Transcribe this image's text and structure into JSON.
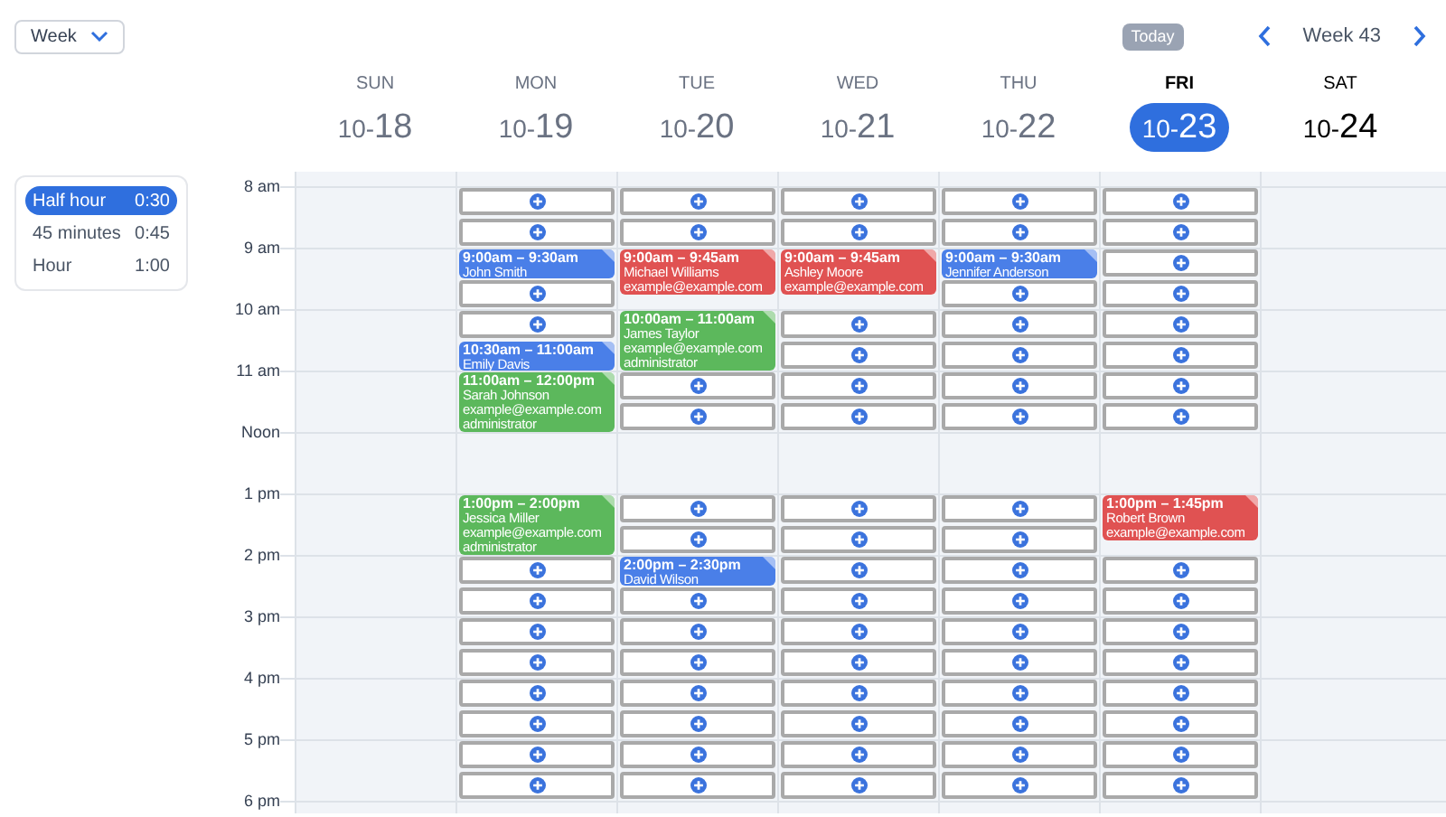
{
  "view_select": {
    "value": "Week"
  },
  "toolbar": {
    "today": "Today",
    "week_label": "Week 43"
  },
  "durations": [
    {
      "label": "Half hour",
      "value": "0:30",
      "selected": true
    },
    {
      "label": "45 minutes",
      "value": "0:45",
      "selected": false
    },
    {
      "label": "Hour",
      "value": "1:00",
      "selected": false
    }
  ],
  "time_labels": [
    "8 am",
    "9 am",
    "10 am",
    "11 am",
    "Noon",
    "1 pm",
    "2 pm",
    "3 pm",
    "4 pm",
    "5 pm",
    "6 pm"
  ],
  "days": [
    {
      "name": "SUN",
      "month": "10-",
      "day": "18",
      "selected": false,
      "past": true
    },
    {
      "name": "MON",
      "month": "10-",
      "day": "19",
      "selected": false,
      "past": true,
      "cells": [
        {
          "kind": "slot"
        },
        {
          "kind": "slot"
        },
        {
          "kind": "short",
          "color": "#4a7fe8",
          "time": "9:00am – 9:30am",
          "lines": [
            "John Smith"
          ]
        },
        {
          "kind": "slot"
        },
        {
          "kind": "slot"
        },
        {
          "kind": "short",
          "color": "#4a7fe8",
          "time": "10:30am – 11:00am",
          "lines": [
            "Emily Davis"
          ]
        },
        {
          "kind": "long",
          "color": "#5cb85c",
          "time": "11:00am – 12:00pm",
          "lines": [
            "Sarah Johnson",
            "example@example.com",
            "administrator"
          ]
        },
        {
          "kind": "break"
        },
        {
          "kind": "long",
          "color": "#5cb85c",
          "time": "1:00pm – 2:00pm",
          "lines": [
            "Jessica Miller",
            "example@example.com",
            "administrator"
          ]
        },
        {
          "kind": "slot"
        },
        {
          "kind": "slot"
        },
        {
          "kind": "slot"
        },
        {
          "kind": "slot"
        },
        {
          "kind": "slot"
        },
        {
          "kind": "slot"
        },
        {
          "kind": "slot"
        },
        {
          "kind": "slot"
        }
      ]
    },
    {
      "name": "TUE",
      "month": "10-",
      "day": "20",
      "selected": false,
      "past": true,
      "cells": [
        {
          "kind": "slot"
        },
        {
          "kind": "slot"
        },
        {
          "kind": "medium",
          "color": "#e05252",
          "time": "9:00am – 9:45am",
          "lines": [
            "Michael Williams",
            "example@example.com"
          ]
        },
        {
          "kind": "long",
          "color": "#5cb85c",
          "time": "10:00am – 11:00am",
          "lines": [
            "James Taylor",
            "example@example.com",
            "administrator"
          ]
        },
        {
          "kind": "slot"
        },
        {
          "kind": "slot"
        },
        {
          "kind": "break"
        },
        {
          "kind": "slot"
        },
        {
          "kind": "slot"
        },
        {
          "kind": "short",
          "color": "#4a7fe8",
          "time": "2:00pm – 2:30pm",
          "lines": [
            "David Wilson"
          ]
        },
        {
          "kind": "slot"
        },
        {
          "kind": "slot"
        },
        {
          "kind": "slot"
        },
        {
          "kind": "slot"
        },
        {
          "kind": "slot"
        },
        {
          "kind": "slot"
        },
        {
          "kind": "slot"
        }
      ]
    },
    {
      "name": "WED",
      "month": "10-",
      "day": "21",
      "selected": false,
      "past": true,
      "cells": [
        {
          "kind": "slot"
        },
        {
          "kind": "slot"
        },
        {
          "kind": "medium",
          "color": "#e05252",
          "time": "9:00am – 9:45am",
          "lines": [
            "Ashley Moore",
            "example@example.com"
          ]
        },
        {
          "kind": "slot"
        },
        {
          "kind": "slot"
        },
        {
          "kind": "slot"
        },
        {
          "kind": "slot"
        },
        {
          "kind": "break"
        },
        {
          "kind": "slot"
        },
        {
          "kind": "slot"
        },
        {
          "kind": "slot"
        },
        {
          "kind": "slot"
        },
        {
          "kind": "slot"
        },
        {
          "kind": "slot"
        },
        {
          "kind": "slot"
        },
        {
          "kind": "slot"
        },
        {
          "kind": "slot"
        },
        {
          "kind": "slot"
        }
      ]
    },
    {
      "name": "THU",
      "month": "10-",
      "day": "22",
      "selected": false,
      "past": true,
      "cells": [
        {
          "kind": "slot"
        },
        {
          "kind": "slot"
        },
        {
          "kind": "short",
          "color": "#4a7fe8",
          "time": "9:00am – 9:30am",
          "lines": [
            "Jennifer Anderson"
          ]
        },
        {
          "kind": "slot"
        },
        {
          "kind": "slot"
        },
        {
          "kind": "slot"
        },
        {
          "kind": "slot"
        },
        {
          "kind": "slot"
        },
        {
          "kind": "break"
        },
        {
          "kind": "slot"
        },
        {
          "kind": "slot"
        },
        {
          "kind": "slot"
        },
        {
          "kind": "slot"
        },
        {
          "kind": "slot"
        },
        {
          "kind": "slot"
        },
        {
          "kind": "slot"
        },
        {
          "kind": "slot"
        },
        {
          "kind": "slot"
        },
        {
          "kind": "slot"
        }
      ]
    },
    {
      "name": "FRI",
      "month": "10-",
      "day": "23",
      "selected": true,
      "past": false,
      "cells": [
        {
          "kind": "slot"
        },
        {
          "kind": "slot"
        },
        {
          "kind": "slot"
        },
        {
          "kind": "slot"
        },
        {
          "kind": "slot"
        },
        {
          "kind": "slot"
        },
        {
          "kind": "slot"
        },
        {
          "kind": "slot"
        },
        {
          "kind": "break"
        },
        {
          "kind": "medium",
          "color": "#e05252",
          "time": "1:00pm – 1:45pm",
          "lines": [
            "Robert Brown",
            "example@example.com"
          ]
        },
        {
          "kind": "slot"
        },
        {
          "kind": "slot"
        },
        {
          "kind": "slot"
        },
        {
          "kind": "slot"
        },
        {
          "kind": "slot"
        },
        {
          "kind": "slot"
        },
        {
          "kind": "slot"
        },
        {
          "kind": "slot"
        }
      ]
    },
    {
      "name": "SAT",
      "month": "10-",
      "day": "24",
      "selected": false,
      "past": false
    }
  ]
}
